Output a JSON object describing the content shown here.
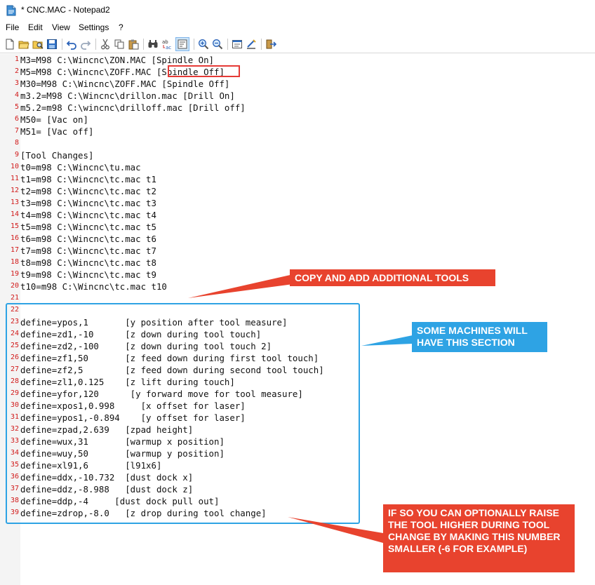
{
  "window": {
    "title": "* CNC.MAC - Notepad2"
  },
  "menu": {
    "items": [
      {
        "label": "File"
      },
      {
        "label": "Edit"
      },
      {
        "label": "View"
      },
      {
        "label": "Settings"
      },
      {
        "label": "?"
      }
    ]
  },
  "toolbar": {
    "buttons": [
      {
        "icon": "new-file-icon"
      },
      {
        "icon": "open-folder-icon"
      },
      {
        "icon": "browse-icon"
      },
      {
        "icon": "save-icon"
      },
      {
        "icon": "undo-icon"
      },
      {
        "icon": "redo-icon"
      },
      {
        "icon": "cut-icon"
      },
      {
        "icon": "copy-icon"
      },
      {
        "icon": "paste-icon"
      },
      {
        "icon": "find-icon"
      },
      {
        "icon": "replace-icon"
      },
      {
        "icon": "word-wrap-icon"
      },
      {
        "icon": "zoom-in-icon"
      },
      {
        "icon": "zoom-out-icon"
      },
      {
        "icon": "scheme-icon"
      },
      {
        "icon": "customize-schemes-icon"
      },
      {
        "icon": "exit-icon"
      }
    ]
  },
  "editor": {
    "lines": [
      {
        "n": "1",
        "text": "M3=M98 C:\\Wincnc\\ZON.MAC [Spindle On]"
      },
      {
        "n": "2",
        "text": "M5=M98 C:\\Wincnc\\ZOFF.MAC [Spindle Off]"
      },
      {
        "n": "3",
        "text": "M30=M98 C:\\Wincnc\\ZOFF.MAC [Spindle Off]"
      },
      {
        "n": "4",
        "text": "m3.2=M98 C:\\Wincnc\\drillon.mac [Drill On]"
      },
      {
        "n": "5",
        "text": "m5.2=m98 C:\\wincnc\\drilloff.mac [Drill off]"
      },
      {
        "n": "6",
        "text": "M50= [Vac on]"
      },
      {
        "n": "7",
        "text": "M51= [Vac off]"
      },
      {
        "n": "8",
        "text": ""
      },
      {
        "n": "9",
        "text": "[Tool Changes]"
      },
      {
        "n": "10",
        "text": "t0=m98 C:\\Wincnc\\tu.mac"
      },
      {
        "n": "11",
        "text": "t1=m98 C:\\Wincnc\\tc.mac t1"
      },
      {
        "n": "12",
        "text": "t2=m98 C:\\Wincnc\\tc.mac t2"
      },
      {
        "n": "13",
        "text": "t3=m98 C:\\Wincnc\\tc.mac t3"
      },
      {
        "n": "14",
        "text": "t4=m98 C:\\Wincnc\\tc.mac t4"
      },
      {
        "n": "15",
        "text": "t5=m98 C:\\Wincnc\\tc.mac t5"
      },
      {
        "n": "16",
        "text": "t6=m98 C:\\Wincnc\\tc.mac t6"
      },
      {
        "n": "17",
        "text": "t7=m98 C:\\Wincnc\\tc.mac t7"
      },
      {
        "n": "18",
        "text": "t8=m98 C:\\Wincnc\\tc.mac t8"
      },
      {
        "n": "19",
        "text": "t9=m98 C:\\Wincnc\\tc.mac t9"
      },
      {
        "n": "20",
        "text": "t10=m98 C:\\Wincnc\\tc.mac t10"
      },
      {
        "n": "21",
        "text": ""
      },
      {
        "n": "22",
        "text": ""
      },
      {
        "n": "23",
        "text": "define=ypos,1       [y position after tool measure]"
      },
      {
        "n": "24",
        "text": "define=zd1,-10      [z down during tool touch]"
      },
      {
        "n": "25",
        "text": "define=zd2,-100     [z down during tool touch 2]"
      },
      {
        "n": "26",
        "text": "define=zf1,50       [z feed down during first tool touch]"
      },
      {
        "n": "27",
        "text": "define=zf2,5        [z feed down during second tool touch]"
      },
      {
        "n": "28",
        "text": "define=zl1,0.125    [z lift during touch]"
      },
      {
        "n": "29",
        "text": "define=yfor,120      [y forward move for tool measure]"
      },
      {
        "n": "30",
        "text": "define=xpos1,0.998     [x offset for laser]"
      },
      {
        "n": "31",
        "text": "define=ypos1,-0.894    [y offset for laser]"
      },
      {
        "n": "32",
        "text": "define=zpad,2.639   [zpad height]"
      },
      {
        "n": "33",
        "text": "define=wux,31       [warmup x position]"
      },
      {
        "n": "34",
        "text": "define=wuy,50       [warmup y position]"
      },
      {
        "n": "35",
        "text": "define=xl91,6       [l91x6]"
      },
      {
        "n": "36",
        "text": "define=ddx,-10.732  [dust dock x]"
      },
      {
        "n": "37",
        "text": "define=ddz,-8.988   [dust dock z]"
      },
      {
        "n": "38",
        "text": "define=ddp,-4     [dust dock pull out]"
      },
      {
        "n": "39",
        "text": "define=zdrop,-8.0   [z drop during tool change]"
      }
    ]
  },
  "annotations": {
    "copy_tools": "COPY AND ADD ADDITIONAL TOOLS",
    "some_machines": "SOME MACHINES WILL HAVE THIS SECTION",
    "raise_tool": "IF SO YOU CAN OPTIONALLY RAISE THE TOOL HIGHER DURING TOOL CHANGE BY MAKING THIS NUMBER SMALLER (-6 FOR EXAMPLE)"
  },
  "colors": {
    "annotation_red": "#e8432e",
    "annotation_blue": "#2ea3e4",
    "line_number": "#d11a1a"
  }
}
